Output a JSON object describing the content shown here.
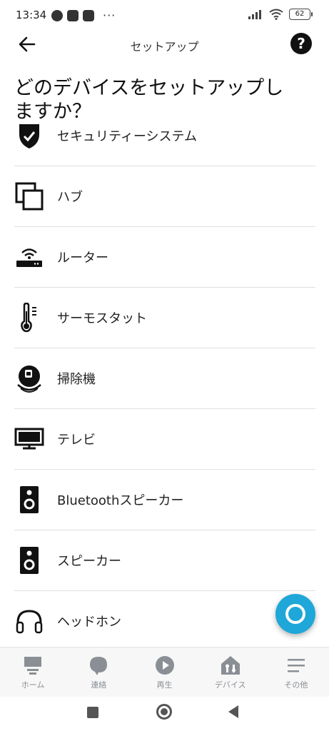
{
  "status_bar": {
    "time": "13:34",
    "battery": "62"
  },
  "header": {
    "title": "セットアップ",
    "help": "?"
  },
  "page_title": "どのデバイスをセットアップしますか？",
  "items": [
    {
      "label": "セキュリティーシステム",
      "icon": "shield-icon"
    },
    {
      "label": "ハブ",
      "icon": "hub-icon"
    },
    {
      "label": "ルーター",
      "icon": "router-icon"
    },
    {
      "label": "サーモスタット",
      "icon": "thermostat-icon"
    },
    {
      "label": "掃除機",
      "icon": "robot-vacuum-icon"
    },
    {
      "label": "テレビ",
      "icon": "tv-icon"
    },
    {
      "label": "Bluetoothスピーカー",
      "icon": "speaker-icon"
    },
    {
      "label": "スピーカー",
      "icon": "speaker-icon"
    },
    {
      "label": "ヘッドホン",
      "icon": "headphones-icon"
    }
  ],
  "bottom_nav": [
    {
      "label": "ホーム",
      "icon": "home-icon"
    },
    {
      "label": "連絡",
      "icon": "chat-icon"
    },
    {
      "label": "再生",
      "icon": "play-icon"
    },
    {
      "label": "デバイス",
      "icon": "devices-icon"
    },
    {
      "label": "その他",
      "icon": "menu-icon"
    }
  ],
  "colors": {
    "accent": "#1ea7d8",
    "tab_inactive": "#8a8f95"
  }
}
